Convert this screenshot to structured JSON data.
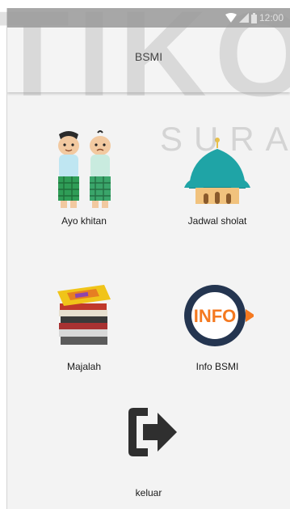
{
  "status_bar": {
    "time": "12:00"
  },
  "app_bar": {
    "title": "BSMI"
  },
  "menu": {
    "items": [
      {
        "label": "Ayo khitan",
        "icon": "boys-khitan-icon"
      },
      {
        "label": "Jadwal sholat",
        "icon": "mosque-icon"
      },
      {
        "label": "Majalah",
        "icon": "magazine-stack-icon"
      },
      {
        "label": "Info BSMI",
        "icon": "info-badge-icon",
        "icon_text": "INFO"
      },
      {
        "label": "keluar",
        "icon": "exit-icon"
      }
    ]
  },
  "watermark": {
    "brand": "TIKO",
    "sub": "SURA"
  },
  "colors": {
    "status_bar": "#a7a7a7",
    "app_bar": "#f4f4f4",
    "mosque_dome": "#1fa4a6",
    "info_orange": "#f47920",
    "info_navy": "#243550"
  }
}
